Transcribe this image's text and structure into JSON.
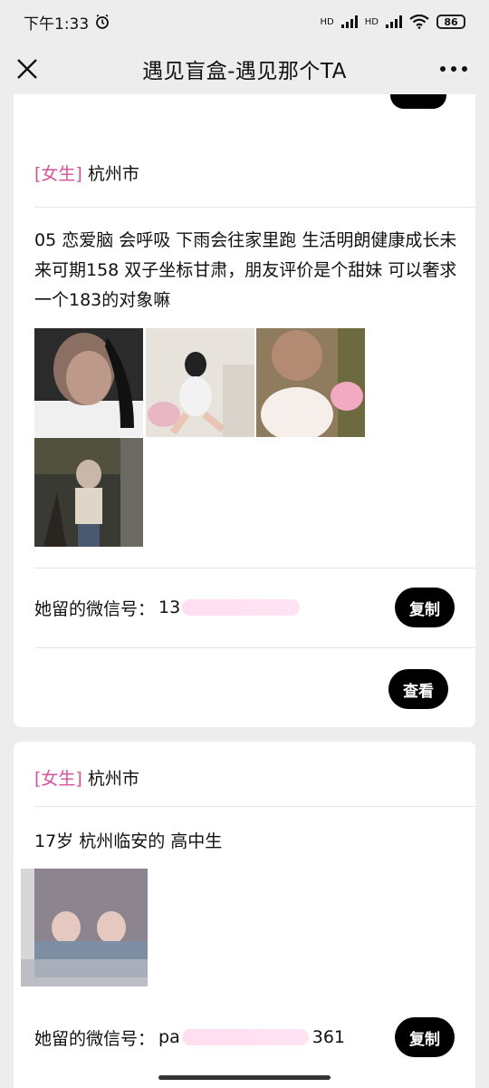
{
  "status_bar": {
    "time": "下午1:33",
    "signal1": "HD",
    "signal2": "HD",
    "battery": "86"
  },
  "nav": {
    "title": "遇见盲盒-遇见那个TA",
    "close_icon": "close-icon",
    "more_icon": "more-icon"
  },
  "cards": [
    {
      "tag": "[女生]",
      "city": "杭州市",
      "description": "05 恋爱脑 会呼吸 下雨会往家里跑 生活明朗健康成长未来可期158 双子坐标甘肃，朋友评价是个甜妹 可以奢求一个183的对象嘛",
      "wechat_label": "她留的微信号：",
      "wechat_value": "13",
      "copy_label": "复制",
      "view_label": "查看"
    },
    {
      "tag": "[女生]",
      "city": "杭州市",
      "description": "17岁 杭州临安的 高中生",
      "wechat_label": "她留的微信号：",
      "wechat_value": "pa",
      "wechat_value_tail": "361",
      "copy_label": "复制"
    }
  ],
  "colors": {
    "tag": "#d6519b",
    "button_bg": "#000000",
    "page_bg": "#ededed",
    "card_bg": "#ffffff"
  }
}
